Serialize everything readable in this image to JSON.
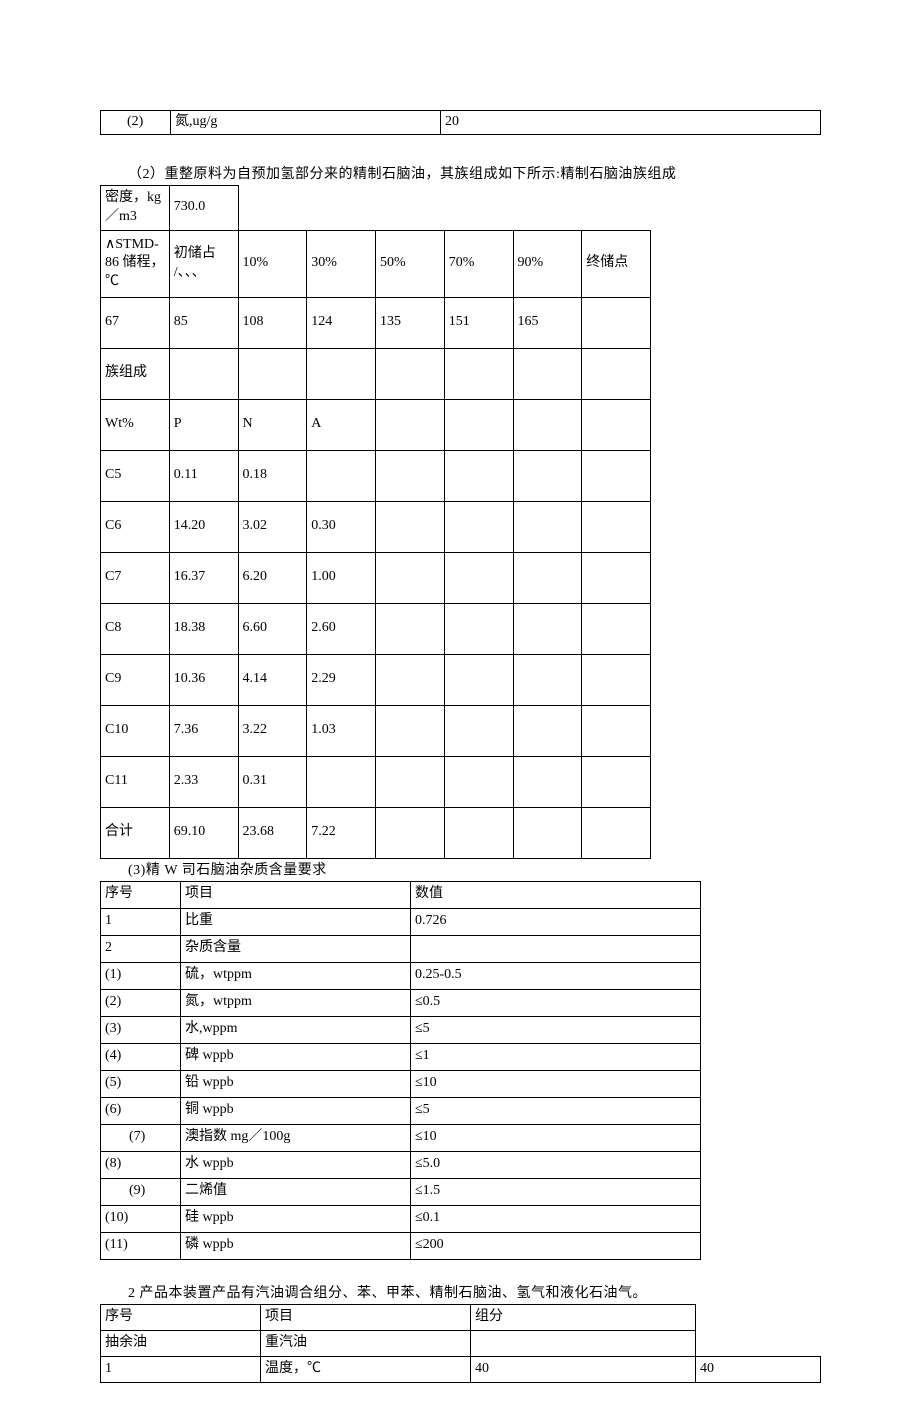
{
  "table1": {
    "row": {
      "c1": "(2)",
      "c2": "氮,ug/g",
      "c3": "20"
    }
  },
  "para2": "（2）重整原料为自预加氢部分来的精制石脑油，其族组成如下所示:精制石脑油族组成",
  "t2h": {
    "r1": {
      "label": "密度，kg／m3",
      "v": "730.0"
    },
    "r2": [
      "∧STMD-86 储程，℃",
      "初储占 /、、、",
      "10%",
      "30%",
      "50%",
      "70%",
      "90%",
      "终储点"
    ],
    "r3": [
      "67",
      "85",
      "108",
      "124",
      "135",
      "151",
      "165",
      ""
    ],
    "r4": [
      "族组成",
      "",
      "",
      "",
      "",
      "",
      "",
      ""
    ],
    "r5": [
      "Wt%",
      "P",
      "N",
      "A",
      "",
      "",
      "",
      ""
    ],
    "r6": [
      "C5",
      "0.11",
      "0.18",
      "",
      "",
      "",
      "",
      ""
    ],
    "r7": [
      "C6",
      "14.20",
      "3.02",
      "0.30",
      "",
      "",
      "",
      ""
    ],
    "r8": [
      "C7",
      "16.37",
      "6.20",
      "1.00",
      "",
      "",
      "",
      ""
    ],
    "r9": [
      "C8",
      "18.38",
      "6.60",
      "2.60",
      "",
      "",
      "",
      ""
    ],
    "r10": [
      "C9",
      "10.36",
      "4.14",
      "2.29",
      "",
      "",
      "",
      ""
    ],
    "r11": [
      "C10",
      "7.36",
      "3.22",
      "1.03",
      "",
      "",
      "",
      ""
    ],
    "r12": [
      "C11",
      "2.33",
      "0.31",
      "",
      "",
      "",
      "",
      ""
    ],
    "r13": [
      "合计",
      "69.10",
      "23.68",
      "7.22",
      "",
      "",
      "",
      ""
    ]
  },
  "para3": "(3)精 W 司石脑油杂质含量要求",
  "t3rows": [
    [
      "序号",
      "项目",
      "数值"
    ],
    [
      "1",
      "比重",
      "0.726"
    ],
    [
      "2",
      "杂质含量",
      ""
    ],
    [
      "(1)",
      "硫，wtppm",
      "0.25-0.5"
    ],
    [
      "(2)",
      "氮，wtppm",
      "≤0.5"
    ],
    [
      "(3)",
      "水,wppm",
      "≤5"
    ],
    [
      "(4)",
      "碑 wppb",
      "≤1"
    ],
    [
      "(5)",
      "铅 wppb",
      "≤10"
    ],
    [
      "(6)",
      "铜 wppb",
      "≤5"
    ],
    [
      "(7)",
      "澳指数 mg／100g",
      "≤10",
      "center"
    ],
    [
      "(8)",
      "水 wppb",
      "≤5.0"
    ],
    [
      "(9)",
      "二烯值",
      "≤1.5",
      "center"
    ],
    [
      "(10)",
      "硅 wppb",
      "≤0.1"
    ],
    [
      "(11)",
      "磷 wppb",
      "≤200"
    ]
  ],
  "para4": "2 产品本装置产品有汽油调合组分、苯、甲苯、精制石脑油、氢气和液化石油气。",
  "t4rows": [
    [
      "序号",
      "项目",
      "组分",
      ""
    ],
    [
      "抽余油",
      "重汽油",
      "",
      ""
    ],
    [
      "1",
      "温度，℃",
      "40",
      "40"
    ]
  ]
}
